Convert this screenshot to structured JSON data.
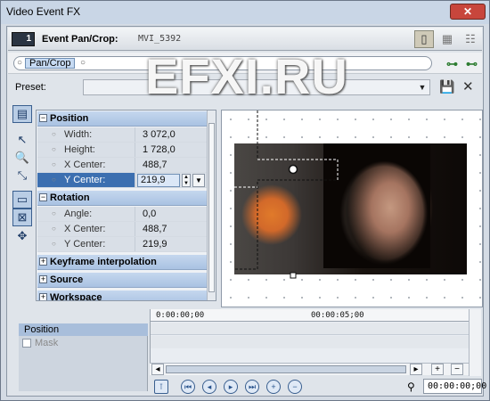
{
  "window": {
    "title": "Video Event FX"
  },
  "header": {
    "badge": "1",
    "plugin_title": "Event Pan/Crop:",
    "media_name": "MVI_5392"
  },
  "chain": {
    "item": "Pan/Crop"
  },
  "preset": {
    "label": "Preset:",
    "value": ""
  },
  "sections": {
    "position": {
      "title": "Position",
      "rows": [
        {
          "name": "Width:",
          "value": "3 072,0"
        },
        {
          "name": "Height:",
          "value": "1 728,0"
        },
        {
          "name": "X Center:",
          "value": "488,7"
        },
        {
          "name": "Y Center:",
          "value": "219,9"
        }
      ]
    },
    "rotation": {
      "title": "Rotation",
      "rows": [
        {
          "name": "Angle:",
          "value": "0,0"
        },
        {
          "name": "X Center:",
          "value": "488,7"
        },
        {
          "name": "Y Center:",
          "value": "219,9"
        }
      ]
    },
    "keyframe": {
      "title": "Keyframe interpolation"
    },
    "source": {
      "title": "Source"
    },
    "workspace": {
      "title": "Workspace"
    }
  },
  "timeline": {
    "start": "0:00:00;00",
    "mid": "00:00:05;00",
    "current": "00:00:00;00"
  },
  "channels": {
    "position": "Position",
    "mask": "Mask"
  },
  "watermark": "EFXI.RU"
}
